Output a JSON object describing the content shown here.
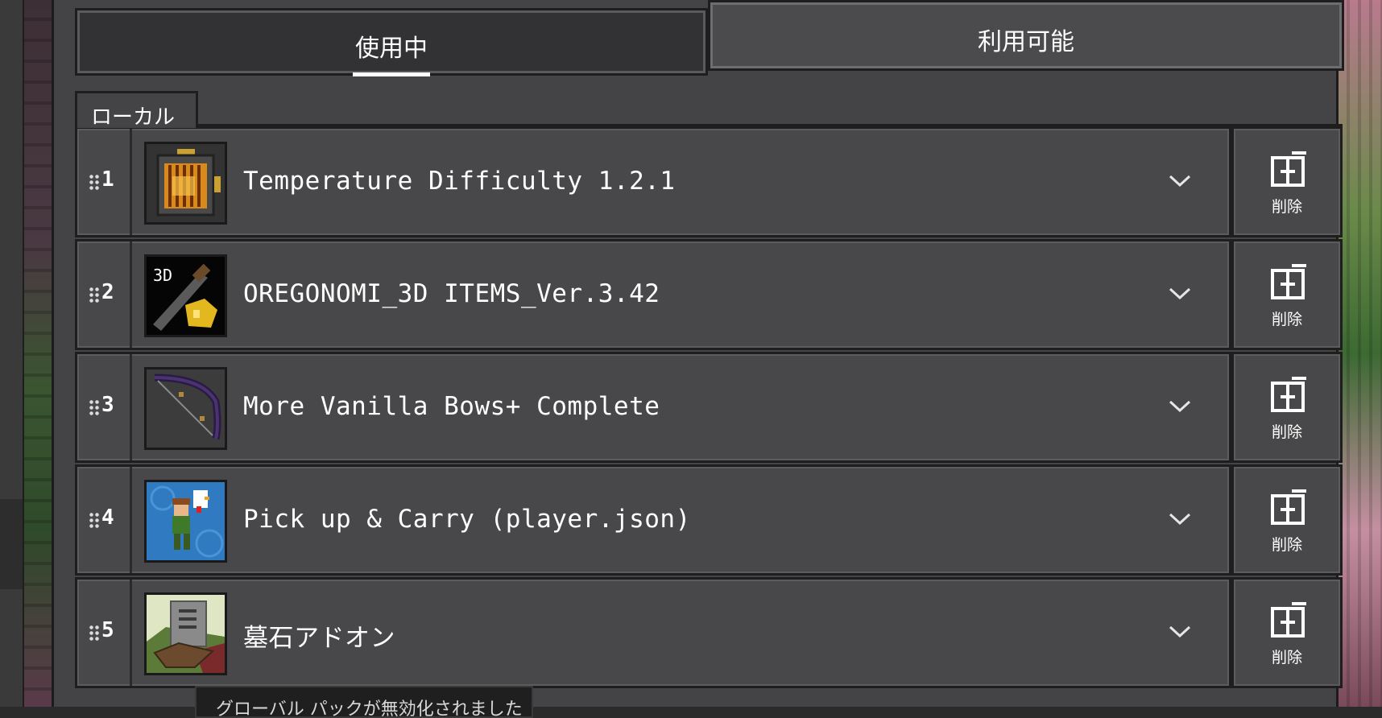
{
  "tabs": {
    "active": "使用中",
    "available": "利用可能"
  },
  "section": {
    "label": "ローカル"
  },
  "packs": [
    {
      "index": "1",
      "name": "Temperature Difficulty 1.2.1",
      "icon": "lantern-pack-icon",
      "remove_label": "削除"
    },
    {
      "index": "2",
      "name": "OREGONOMI_3D ITEMS_Ver.3.42",
      "icon": "3d-items-pack-icon",
      "remove_label": "削除"
    },
    {
      "index": "3",
      "name": "More Vanilla Bows+ Complete",
      "icon": "bow-pack-icon",
      "remove_label": "削除"
    },
    {
      "index": "4",
      "name": "Pick up & Carry  (player.json)",
      "icon": "carry-pack-icon",
      "remove_label": "削除"
    },
    {
      "index": "5",
      "name": "墓石アドオン",
      "icon": "gravestone-pack-icon",
      "remove_label": "削除"
    }
  ],
  "toast": {
    "text": "グローバル パックが無効化されました"
  },
  "colors": {
    "panel": "#444446",
    "row": "#48484a",
    "border": "#1e1e1e",
    "text": "#ffffff"
  }
}
